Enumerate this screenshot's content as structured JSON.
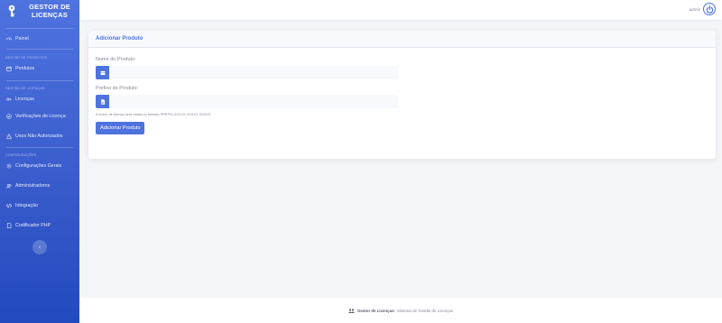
{
  "sidebar": {
    "brand": "GESTOR DE LICENÇAS",
    "brand_icon": "key-icon",
    "items": [
      {
        "label": "Painel",
        "icon": "gauge-icon"
      },
      {
        "heading": "GESTÃO DE PRODUTOS"
      },
      {
        "label": "Produtos",
        "icon": "box-icon"
      },
      {
        "heading": "GESTÃO DE LICENÇAS"
      },
      {
        "label": "Licenças",
        "icon": "key-icon"
      },
      {
        "label": "Verificações de Licença",
        "icon": "check-circle-icon"
      },
      {
        "label": "Usos Não Autorizados",
        "icon": "warning-icon"
      },
      {
        "heading": "CONFIGURAÇÕES"
      },
      {
        "label": "Configurações Gerais",
        "icon": "gear-icon"
      },
      {
        "label": "Administradores",
        "icon": "users-icon"
      },
      {
        "label": "Integração",
        "icon": "code-icon"
      },
      {
        "label": "Codificador PHP",
        "icon": "file-code-icon"
      }
    ],
    "toggle_icon": "chevron-left-icon",
    "toggle_glyph": "‹"
  },
  "topbar": {
    "user_name": "admin",
    "avatar_icon": "power-icon"
  },
  "card": {
    "title": "Adicionar Produto",
    "fields": [
      {
        "label": "Nome do Produto:",
        "value": "",
        "placeholder": "",
        "icon": "box-icon"
      },
      {
        "label": "Prefixo do Produto:",
        "value": "",
        "placeholder": "",
        "icon": "file-icon"
      }
    ],
    "help": "A chave de licença será criada no formato PREFIX-XXXXX-XXXXX-XXXXX",
    "submit_label": "Adicionar Produto"
  },
  "footer": {
    "icon": "users-icon",
    "brand": "Gestor de Licenças",
    "text": "Sistema de Gestão de Licenças"
  },
  "colors": {
    "primary": "#4e73df",
    "sidebar_gradient_end": "#224abe",
    "page_background": "#f4f5f9"
  }
}
